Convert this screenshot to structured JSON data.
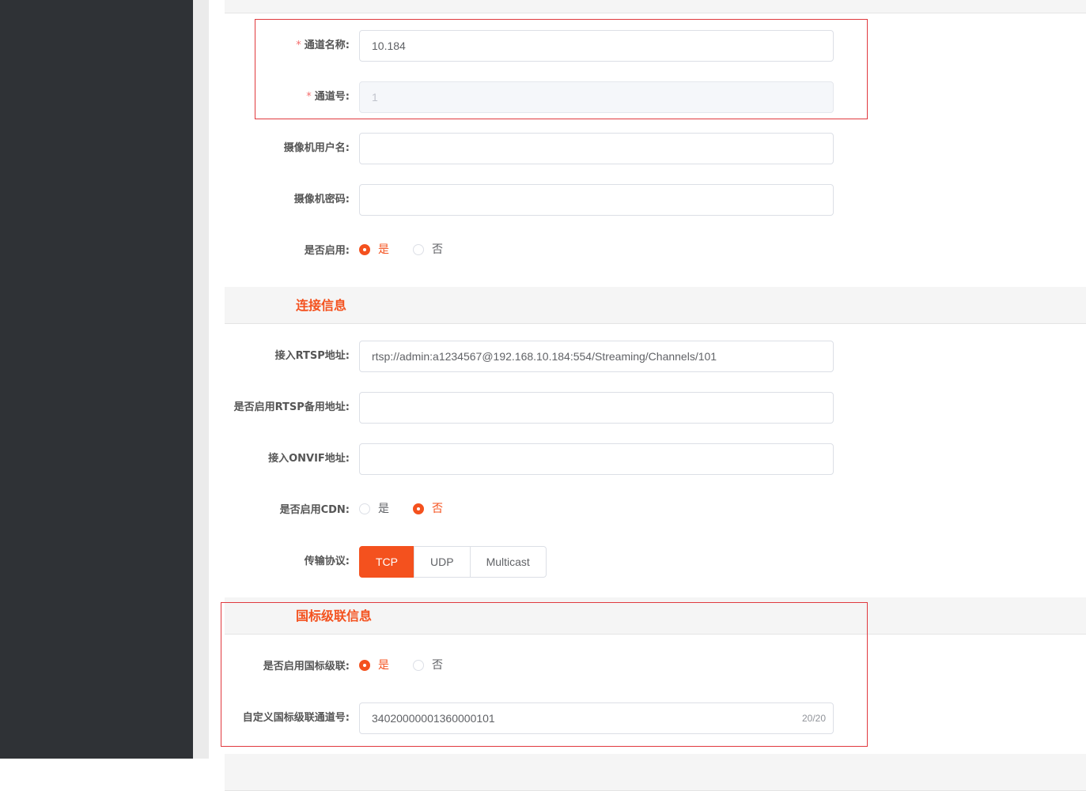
{
  "basic": {
    "channel_name_label": "通道名称:",
    "channel_name_value": "10.184",
    "channel_no_label": "通道号:",
    "channel_no_value": "1",
    "cam_user_label": "摄像机用户名:",
    "cam_user_value": "",
    "cam_pwd_label": "摄像机密码:",
    "cam_pwd_value": "",
    "enable_label": "是否启用:",
    "enable_options": [
      "是",
      "否"
    ],
    "enable_selected": "是"
  },
  "connection": {
    "title": "连接信息",
    "rtsp_label": "接入RTSP地址:",
    "rtsp_value": "rtsp://admin:a1234567@192.168.10.184:554/Streaming/Channels/101",
    "rtsp_backup_label": "是否启用RTSP备用地址:",
    "rtsp_backup_value": "",
    "onvif_label": "接入ONVIF地址:",
    "onvif_value": "",
    "cdn_label": "是否启用CDN:",
    "cdn_options": [
      "是",
      "否"
    ],
    "cdn_selected": "否",
    "protocol_label": "传输协议:",
    "protocol_options": [
      "TCP",
      "UDP",
      "Multicast"
    ],
    "protocol_selected": "TCP"
  },
  "gb_cascade": {
    "title": "国标级联信息",
    "enable_label": "是否启用国标级联:",
    "enable_options": [
      "是",
      "否"
    ],
    "enable_selected": "是",
    "channel_id_label": "自定义国标级联通道号:",
    "channel_id_value": "34020000001360000101",
    "channel_id_count": "20/20"
  },
  "colors": {
    "accent": "#f4511e",
    "highlight_border": "#e0393e",
    "sidebar": "#2f3236"
  }
}
